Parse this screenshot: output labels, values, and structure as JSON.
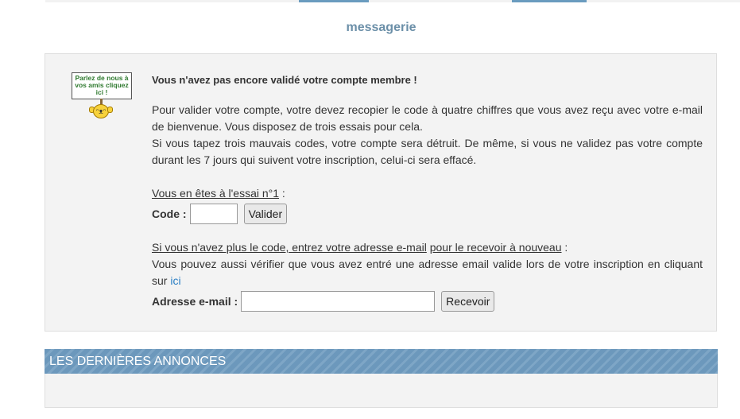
{
  "page": {
    "title": "messagerie"
  },
  "sign": {
    "text": "Parlez de nous à vos amis cliquez ici !"
  },
  "validation": {
    "heading": "Vous n'avez pas encore validé votre compte membre !",
    "paragraph1": "Pour valider votre compte, votre devez recopier le code à quatre chiffres que vous avez reçu avec votre e-mail de bienvenue. Vous disposez de trois essais pour cela.",
    "paragraph2": "Si vous tapez trois mauvais codes, votre compte sera détruit. De même, si vous ne validez pas votre compte durant les 7 jours qui suivent votre inscription, celui-ci sera effacé.",
    "attempt_label": "Vous en êtes à l'essai n°1",
    "attempt_suffix": " :",
    "code_label": "Code :",
    "code_value": "",
    "validate_button": "Valider"
  },
  "resend": {
    "lead_underlined_1": "Si vous n'avez plus le code, entrez votre adresse e-mail",
    "lead_plain": " ",
    "lead_underlined_2": "pour le recevoir à nouveau",
    "lead_suffix": " :",
    "check_text": "Vous pouvez aussi vérifier que vous avez entré une adresse email valide lors de votre inscription en cliquant sur ",
    "check_link": "ici",
    "email_label": "Adresse e-mail :",
    "email_value": "",
    "receive_button": "Recevoir"
  },
  "announcements": {
    "title": "LES DERNIÈRES ANNONCES"
  },
  "colors": {
    "title": "#6b8fa8",
    "bar": "#6c98bc",
    "link": "#2a7ec4",
    "sign_text": "#2f7a2f"
  },
  "icons": {
    "sign": "smiley-sign-icon"
  }
}
